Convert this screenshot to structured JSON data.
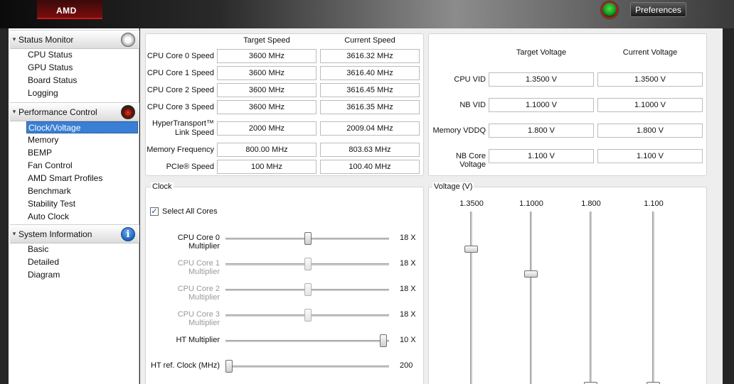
{
  "header": {
    "logo_text": "AMD",
    "preferences_label": "Preferences",
    "status_color": "#2fbf37"
  },
  "sidebar": {
    "sections": [
      {
        "label": "Status Monitor",
        "icon": "gauge-icon",
        "items": [
          "CPU Status",
          "GPU Status",
          "Board Status",
          "Logging"
        ]
      },
      {
        "label": "Performance Control",
        "icon": "performance-icon",
        "items": [
          "Clock/Voltage",
          "Memory",
          "BEMP",
          "Fan Control",
          "AMD Smart Profiles",
          "Benchmark",
          "Stability Test",
          "Auto Clock"
        ]
      },
      {
        "label": "System Information",
        "icon": "info-icon",
        "icon_glyph": "i",
        "items": [
          "Basic",
          "Detailed",
          "Diagram"
        ]
      }
    ],
    "selected_item": "Clock/Voltage"
  },
  "speed": {
    "col_target": "Target Speed",
    "col_current": "Current Speed",
    "rows": [
      {
        "label": "CPU Core 0 Speed",
        "target": "3600 MHz",
        "current": "3616.32 MHz"
      },
      {
        "label": "CPU Core 1 Speed",
        "target": "3600 MHz",
        "current": "3616.40 MHz"
      },
      {
        "label": "CPU Core 2 Speed",
        "target": "3600 MHz",
        "current": "3616.45 MHz"
      },
      {
        "label": "CPU Core 3 Speed",
        "target": "3600 MHz",
        "current": "3616.35 MHz"
      },
      {
        "label": "HyperTransport™ Link Speed",
        "label_line1": "HyperTransport™",
        "label_line2": "Link Speed",
        "target": "2000 MHz",
        "current": "2009.04 MHz"
      },
      {
        "label": "Memory Frequency",
        "target": "800.00 MHz",
        "current": "803.63 MHz"
      },
      {
        "label": "PCIe® Speed",
        "target": "100 MHz",
        "current": "100.40 MHz"
      }
    ]
  },
  "voltage_table": {
    "col_target": "Target Voltage",
    "col_current": "Current Voltage",
    "rows": [
      {
        "label": "CPU VID",
        "target": "1.3500 V",
        "current": "1.3500 V"
      },
      {
        "label": "NB VID",
        "target": "1.1000 V",
        "current": "1.1000 V"
      },
      {
        "label": "Memory VDDQ",
        "target": "1.800 V",
        "current": "1.800 V"
      },
      {
        "label": "NB Core Voltage",
        "target": "1.100 V",
        "current": "1.100 V"
      }
    ]
  },
  "clock": {
    "title": "Clock",
    "select_all_label": "Select All Cores",
    "select_all_checked": true,
    "check_glyph": "✓",
    "sliders": [
      {
        "label": "CPU Core 0 Multiplier",
        "value": "18 X",
        "position": 0.505,
        "enabled": true
      },
      {
        "label": "CPU Core 1 Multiplier",
        "value": "18 X",
        "position": 0.505,
        "enabled": false
      },
      {
        "label": "CPU Core 2 Multiplier",
        "value": "18 X",
        "position": 0.505,
        "enabled": false
      },
      {
        "label": "CPU Core 3 Multiplier",
        "value": "18 X",
        "position": 0.505,
        "enabled": false
      },
      {
        "label": "HT Multiplier",
        "value": "10 X",
        "position": 0.985,
        "enabled": true
      },
      {
        "label": "HT ref. Clock (MHz)",
        "value": "200",
        "position": 0.0,
        "enabled": true
      }
    ]
  },
  "voltage_sliders": {
    "title": "Voltage (V)",
    "items": [
      {
        "value": "1.3500",
        "position": 0.19
      },
      {
        "value": "1.1000",
        "position": 0.33
      },
      {
        "value": "1.800",
        "position": 0.96
      },
      {
        "value": "1.100",
        "position": 0.96
      }
    ]
  }
}
